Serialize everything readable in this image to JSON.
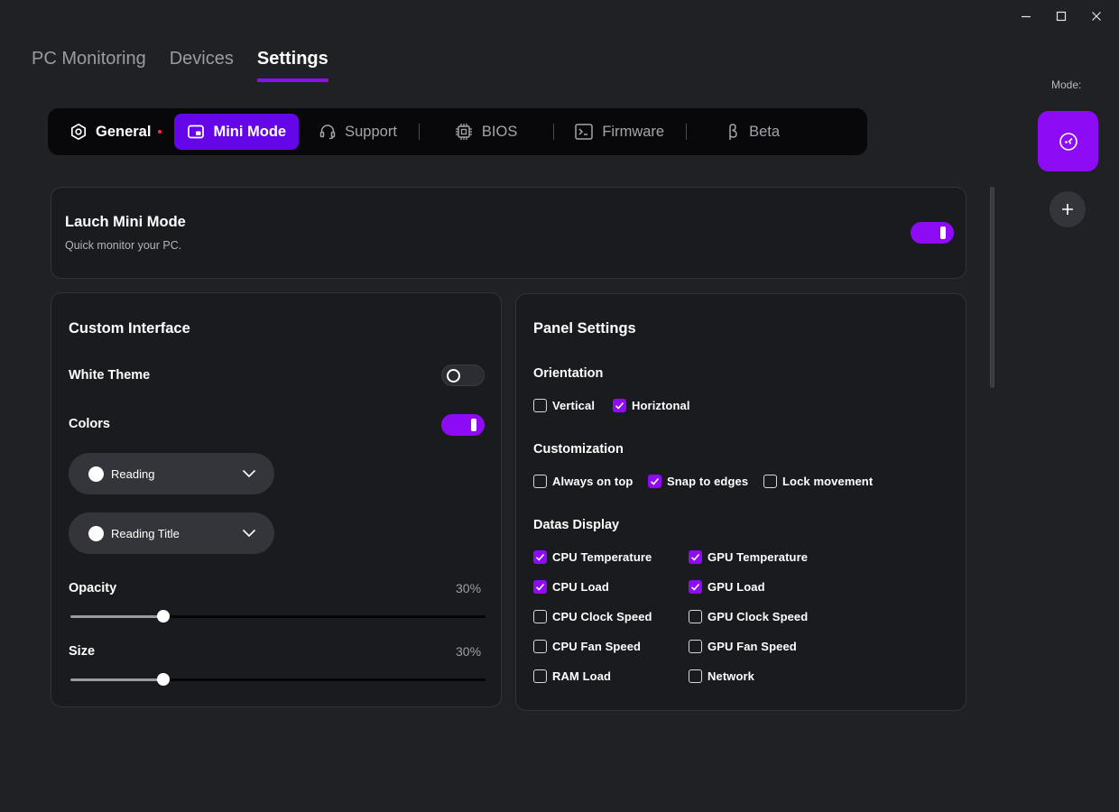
{
  "window": {
    "minimize_icon": "minimize-icon",
    "maximize_icon": "maximize-icon",
    "close_icon": "close-icon"
  },
  "main_tabs": [
    {
      "label": "PC Monitoring",
      "active": false
    },
    {
      "label": "Devices",
      "active": false
    },
    {
      "label": "Settings",
      "active": true
    }
  ],
  "sub_tabs": [
    {
      "label": "General",
      "icon": "hexagon-gear-icon",
      "has_dot": true
    },
    {
      "label": "Mini Mode",
      "icon": "mini-mode-icon",
      "active": true
    },
    {
      "label": "Support",
      "icon": "headset-icon"
    },
    {
      "label": "BIOS",
      "icon": "chip-icon"
    },
    {
      "label": "Firmware",
      "icon": "terminal-icon"
    },
    {
      "label": "Beta",
      "icon": "beta-icon"
    }
  ],
  "side": {
    "mode_label": "Mode:",
    "mode_icon": "gauge-icon",
    "add_icon": "plus-icon"
  },
  "launch": {
    "title": "Lauch Mini Mode",
    "subtitle": "Quick monitor your PC.",
    "enabled": true
  },
  "custom": {
    "title": "Custom Interface",
    "white_theme_label": "White Theme",
    "white_theme": false,
    "colors_label": "Colors",
    "colors": true,
    "dropdowns": [
      {
        "label": "Reading",
        "color": "#ffffff"
      },
      {
        "label": "Reading Title",
        "color": "#ffffff"
      }
    ],
    "opacity_label": "Opacity",
    "opacity_value": "30%",
    "opacity": 0.3,
    "size_label": "Size",
    "size_value": "30%",
    "size": 0.3
  },
  "panel": {
    "title": "Panel Settings",
    "orientation_label": "Orientation",
    "orientation": [
      {
        "label": "Vertical",
        "checked": false
      },
      {
        "label": "Horiztonal",
        "checked": true
      }
    ],
    "customization_label": "Customization",
    "customization": [
      {
        "label": "Always on top",
        "checked": false
      },
      {
        "label": "Snap to edges",
        "checked": true
      },
      {
        "label": "Lock movement",
        "checked": false
      }
    ],
    "datas_label": "Datas Display",
    "datas": [
      {
        "label": "CPU Temperature",
        "checked": true
      },
      {
        "label": "GPU Temperature",
        "checked": true
      },
      {
        "label": "CPU Load",
        "checked": true
      },
      {
        "label": "GPU Load",
        "checked": true
      },
      {
        "label": "CPU Clock Speed",
        "checked": false
      },
      {
        "label": "GPU Clock Speed",
        "checked": false
      },
      {
        "label": "CPU Fan Speed",
        "checked": false
      },
      {
        "label": "GPU Fan Speed",
        "checked": false
      },
      {
        "label": "RAM Load",
        "checked": false
      },
      {
        "label": "Network",
        "checked": false
      }
    ]
  },
  "colors": {
    "accent": "#8d0cf5",
    "active_tab": "#6406e8",
    "background": "#202124",
    "card": "#1a1b1e"
  }
}
